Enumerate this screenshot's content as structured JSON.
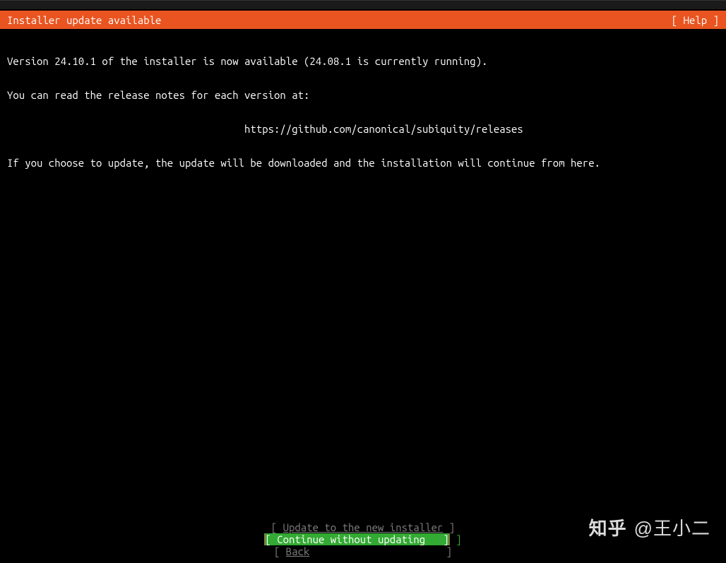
{
  "header": {
    "title": "Installer update available",
    "help": "[ Help ]"
  },
  "body": {
    "line1": "Version 24.10.1 of the installer is now available (24.08.1 is currently running).",
    "line2": "You can read the release notes for each version at:",
    "url": "https://github.com/canonical/subiquity/releases",
    "line3": "If you choose to update, the update will be downloaded and the installation will continue from here."
  },
  "buttons": {
    "update": "Update to the new installer",
    "continue": "Continue without updating",
    "back": "Back"
  },
  "watermark": {
    "logo": "知乎",
    "author": "@王小二"
  }
}
